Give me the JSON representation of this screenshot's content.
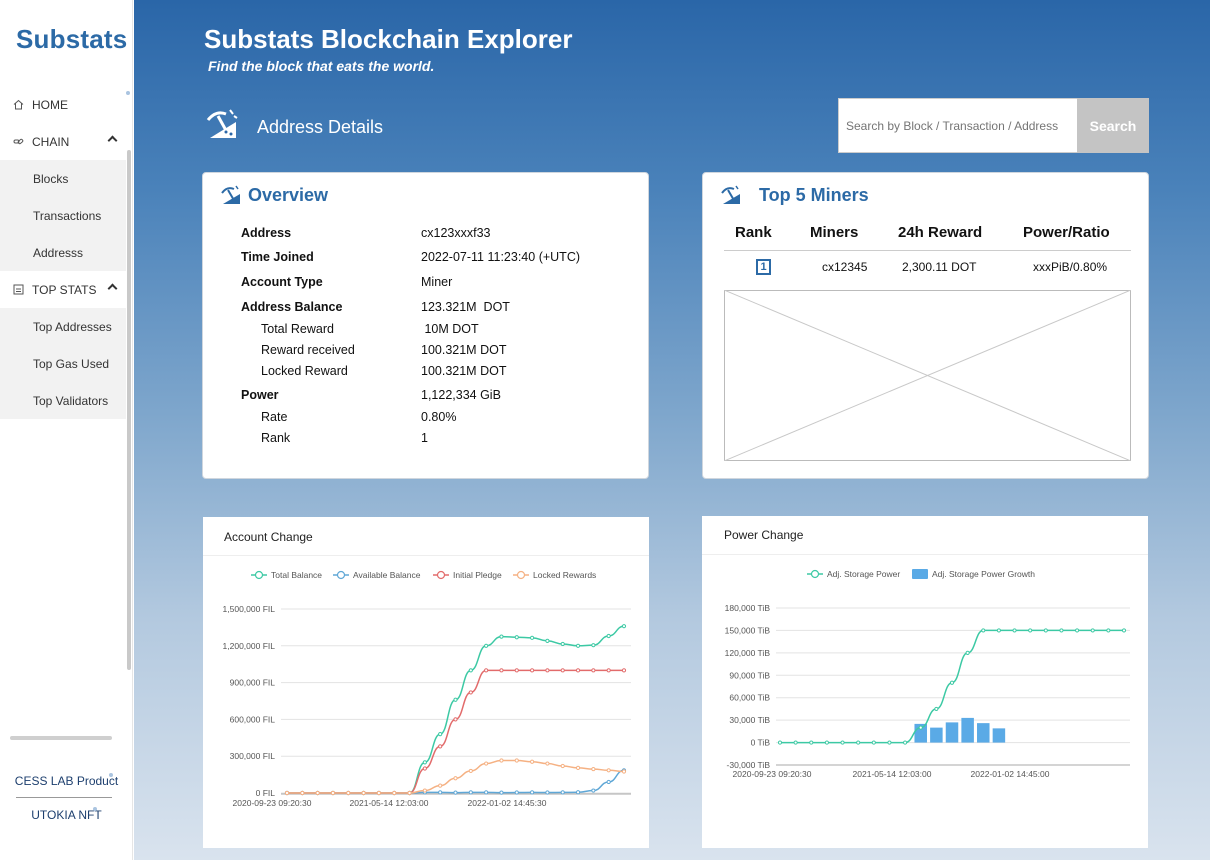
{
  "app": {
    "logo": "Substats"
  },
  "sidebar": {
    "items": [
      {
        "label": "HOME",
        "icon": "home-icon"
      },
      {
        "label": "CHAIN",
        "icon": "link-icon",
        "children": [
          "Blocks",
          "Transactions",
          "Addresss"
        ]
      },
      {
        "label": "TOP STATS",
        "icon": "stats-icon",
        "children": [
          "Top Addresses",
          "Top Gas Used",
          "Top Validators"
        ]
      }
    ],
    "footer": [
      "CESS LAB Product",
      "UTOKIA NFT"
    ]
  },
  "header": {
    "title": "Substats Blockchain Explorer",
    "tagline": "Find the block that eats the world."
  },
  "page": {
    "title": "Address Details"
  },
  "search": {
    "placeholder": "Search by Block / Transaction / Address",
    "button": "Search"
  },
  "overview": {
    "title": "Overview",
    "rows": [
      {
        "label": "Address",
        "value": "cx123xxxf33",
        "level": 0
      },
      {
        "label": "Time Joined",
        "value": "2022-07-11 11:23:40 (+UTC)",
        "level": 0
      },
      {
        "label": "Account Type",
        "value": "Miner",
        "level": 0
      },
      {
        "label": "Address Balance",
        "value": "123.321M  DOT",
        "level": 0
      },
      {
        "label": "Total Reward",
        "value": " 10M DOT",
        "level": 1
      },
      {
        "label": "Reward received",
        "value": "100.321M DOT",
        "level": 1
      },
      {
        "label": "Locked Reward",
        "value": "100.321M DOT",
        "level": 1
      },
      {
        "label": "Power",
        "value": "1,122,334 GiB",
        "level": 0
      },
      {
        "label": "Rate",
        "value": "0.80%",
        "level": 1
      },
      {
        "label": "Rank",
        "value": "1",
        "level": 1
      }
    ]
  },
  "top_miners": {
    "title": "Top 5 Miners",
    "headers": [
      "Rank",
      "Miners",
      "24h Reward",
      "Power/Ratio"
    ],
    "rows": [
      {
        "rank": "1",
        "miner": "cx12345",
        "reward": "2,300.11 DOT",
        "power": "xxxPiB/0.80%"
      }
    ]
  },
  "chart_data": [
    {
      "type": "line",
      "title": "Account Change",
      "x_ticks": [
        "2020-09-23 09:20:30",
        "2021-05-14 12:03:00",
        "2022-01-02 14:45:30"
      ],
      "y_ticks": [
        "0 FIL",
        "300,000 FIL",
        "600,000 FIL",
        "900,000 FIL",
        "1,200,000 FIL",
        "1,500,000 FIL"
      ],
      "ylim": [
        0,
        1500000
      ],
      "legend_position": "top",
      "series": [
        {
          "name": "Total Balance",
          "color": "#3cc9a4",
          "values": [
            0,
            0,
            0,
            0,
            0,
            0,
            0,
            0,
            0,
            250000,
            480000,
            760000,
            1000000,
            1200000,
            1275000,
            1270000,
            1265000,
            1240000,
            1215000,
            1200000,
            1205000,
            1280000,
            1360000
          ]
        },
        {
          "name": "Available Balance",
          "color": "#5fa7d6",
          "values": [
            0,
            0,
            0,
            0,
            0,
            0,
            0,
            0,
            0,
            5000,
            5000,
            3000,
            5000,
            5000,
            3000,
            4000,
            5000,
            4000,
            5000,
            6000,
            20000,
            90000,
            185000
          ]
        },
        {
          "name": "Initial Pledge",
          "color": "#e26b6b",
          "values": [
            0,
            0,
            0,
            0,
            0,
            0,
            0,
            0,
            0,
            200000,
            380000,
            600000,
            820000,
            1000000,
            1000000,
            1000000,
            1000000,
            1000000,
            1000000,
            1000000,
            1000000,
            1000000,
            1000000
          ]
        },
        {
          "name": "Locked Rewards",
          "color": "#f5b183",
          "values": [
            0,
            0,
            0,
            0,
            0,
            0,
            0,
            0,
            0,
            20000,
            60000,
            120000,
            180000,
            240000,
            265000,
            265000,
            255000,
            240000,
            220000,
            205000,
            195000,
            185000,
            175000
          ]
        }
      ]
    },
    {
      "type": "line",
      "title": "Power Change",
      "x_ticks": [
        "2020-09-23 09:20:30",
        "2021-05-14 12:03:00",
        "2022-01-02 14:45:00"
      ],
      "y_ticks": [
        "-30,000 TiB",
        "0 TiB",
        "30,000 TiB",
        "60,000 TiB",
        "90,000 TiB",
        "120,000 TiB",
        "150,000 TiB",
        "180,000 TiB"
      ],
      "ylim": [
        -30000,
        180000
      ],
      "legend_position": "top",
      "series": [
        {
          "name": "Adj. Storage Power",
          "type": "line",
          "color": "#3cc9a4",
          "values": [
            0,
            0,
            0,
            0,
            0,
            0,
            0,
            0,
            0,
            20000,
            45000,
            80000,
            120000,
            150000,
            150000,
            150000,
            150000,
            150000,
            150000,
            150000,
            150000,
            150000,
            150000
          ]
        },
        {
          "name": "Adj. Storage Power Growth",
          "type": "bar",
          "color": "#5aaae6",
          "values": [
            0,
            0,
            0,
            0,
            0,
            0,
            0,
            0,
            0,
            25000,
            20000,
            27000,
            33000,
            26000,
            19000,
            0,
            0,
            0,
            0,
            0,
            0,
            0,
            0
          ]
        }
      ]
    }
  ]
}
